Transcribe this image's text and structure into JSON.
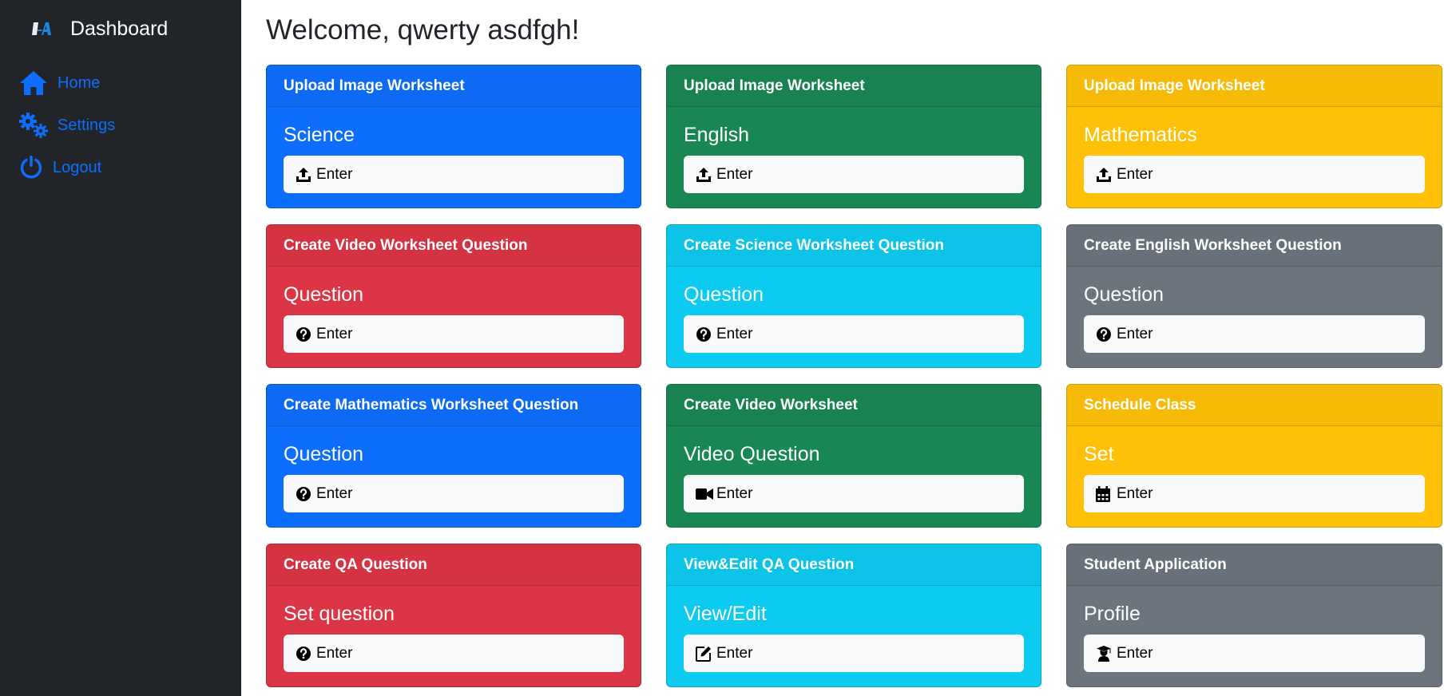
{
  "sidebar": {
    "brand_title": "Dashboard",
    "items": [
      {
        "label": "Home",
        "icon": "home-icon"
      },
      {
        "label": "Settings",
        "icon": "gears-icon"
      },
      {
        "label": "Logout",
        "icon": "power-icon"
      }
    ]
  },
  "main": {
    "welcome": "Welcome, qwerty asdfgh!",
    "cards": [
      {
        "header": "Upload Image Worksheet",
        "title": "Science",
        "button": "Enter",
        "icon": "upload-icon",
        "color": "#0d6efd"
      },
      {
        "header": "Upload Image Worksheet",
        "title": "English",
        "button": "Enter",
        "icon": "upload-icon",
        "color": "#198754"
      },
      {
        "header": "Upload Image Worksheet",
        "title": "Mathematics",
        "button": "Enter",
        "icon": "upload-icon",
        "color": "#ffc107"
      },
      {
        "header": "Create Video Worksheet Question",
        "title": "Question",
        "button": "Enter",
        "icon": "question-circle-icon",
        "color": "#dc3545"
      },
      {
        "header": "Create Science Worksheet Question",
        "title": "Question",
        "button": "Enter",
        "icon": "question-circle-icon",
        "color": "#0dcaf0"
      },
      {
        "header": "Create English Worksheet Question",
        "title": "Question",
        "button": "Enter",
        "icon": "question-circle-icon",
        "color": "#6c757d"
      },
      {
        "header": "Create Mathematics Worksheet Question",
        "title": "Question",
        "button": "Enter",
        "icon": "question-circle-icon",
        "color": "#0d6efd"
      },
      {
        "header": "Create Video Worksheet",
        "title": "Video Question",
        "button": "Enter",
        "icon": "video-camera-icon",
        "color": "#198754"
      },
      {
        "header": "Schedule Class",
        "title": "Set",
        "button": "Enter",
        "icon": "calendar-icon",
        "color": "#ffc107"
      },
      {
        "header": "Create QA Question",
        "title": "Set question",
        "button": "Enter",
        "icon": "question-circle-icon",
        "color": "#dc3545"
      },
      {
        "header": "View&Edit QA Question",
        "title": "View/Edit",
        "button": "Enter",
        "icon": "edit-icon",
        "color": "#0dcaf0"
      },
      {
        "header": "Student Application",
        "title": "Profile",
        "button": "Enter",
        "icon": "graduate-icon",
        "color": "#6c757d"
      }
    ]
  }
}
